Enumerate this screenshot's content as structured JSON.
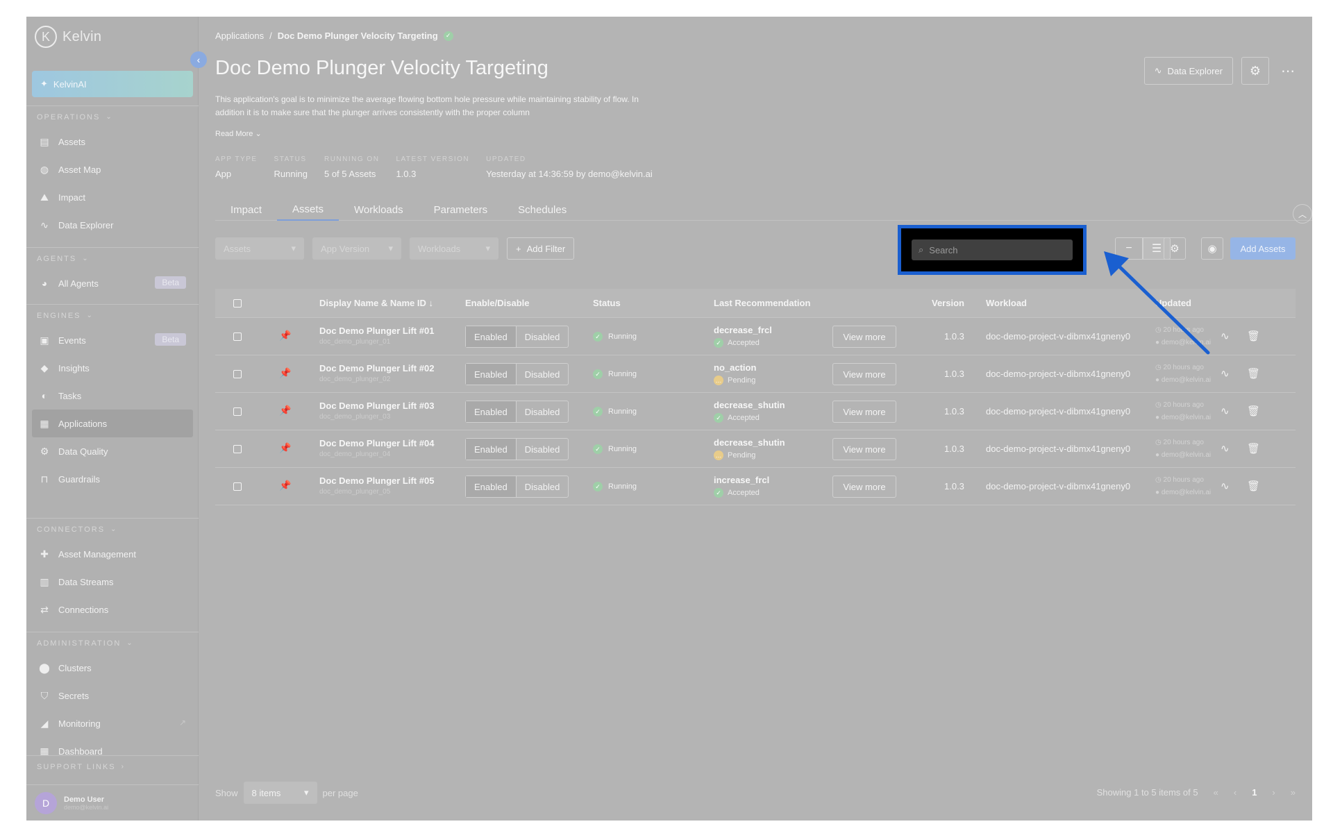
{
  "brand": {
    "logo_letter": "K",
    "name": "Kelvin"
  },
  "sidebar": {
    "kelvinai": "KelvinAI",
    "sections": [
      {
        "title": "OPERATIONS",
        "items": [
          "Assets",
          "Asset Map",
          "Impact",
          "Data Explorer"
        ]
      },
      {
        "title": "AGENTS",
        "items": [
          "All Agents"
        ]
      },
      {
        "title": "ENGINES",
        "items": [
          "Events",
          "Insights",
          "Tasks",
          "Applications",
          "Data Quality",
          "Guardrails"
        ]
      },
      {
        "title": "CONNECTORS",
        "items": [
          "Asset Management",
          "Data Streams",
          "Connections"
        ]
      },
      {
        "title": "ADMINISTRATION",
        "items": [
          "Clusters",
          "Secrets",
          "Monitoring",
          "Dashboard"
        ]
      }
    ],
    "badge": "Beta",
    "support_links": "SUPPORT LINKS",
    "user": {
      "initial": "D",
      "name": "Demo User",
      "email": "demo@kelvin.ai"
    }
  },
  "breadcrumb": {
    "root": "Applications",
    "separator": "/",
    "current": "Doc Demo Plunger Velocity Targeting"
  },
  "page": {
    "title": "Doc Demo Plunger Velocity Targeting",
    "description": "This application's goal is to minimize the average flowing bottom hole pressure while maintaining stability of flow. In addition it is to make sure that the plunger arrives consistently with the proper column",
    "read_more": "Read More",
    "data_explorer_button": "Data Explorer"
  },
  "meta": [
    {
      "label": "APP TYPE",
      "value": "App"
    },
    {
      "label": "STATUS",
      "value": "Running"
    },
    {
      "label": "RUNNING ON",
      "value": "5 of 5 Assets"
    },
    {
      "label": "LATEST VERSION",
      "value": "1.0.3"
    },
    {
      "label": "UPDATED",
      "value": "Yesterday at 14:36:59 by demo@kelvin.ai"
    }
  ],
  "tabs": [
    "Impact",
    "Assets",
    "Workloads",
    "Parameters",
    "Schedules"
  ],
  "active_tab": "Assets",
  "filters": {
    "assets": "Assets",
    "app_version": "App Version",
    "workloads": "Workloads",
    "add_filter": "Add Filter"
  },
  "search": {
    "placeholder": "Search"
  },
  "add_assets": "Add Assets",
  "table": {
    "headers": {
      "name": "Display Name & Name ID",
      "enable": "Enable/Disable",
      "status": "Status",
      "recommendation": "Last Recommendation",
      "version": "Version",
      "workload": "Workload",
      "updated": "Updated"
    },
    "enabled_label": "Enabled",
    "disabled_label": "Disabled",
    "view_more_label": "View more",
    "rows": [
      {
        "name": "Doc Demo Plunger Lift #01",
        "name_id": "doc_demo_plunger_01",
        "status": "Running",
        "rec": "decrease_frcl",
        "rec_status": "Accepted",
        "version": "1.0.3",
        "workload": "doc-demo-project-v-dibmx41gneny0",
        "updated_time": "20 hours ago",
        "updated_by": "demo@kelvin.ai"
      },
      {
        "name": "Doc Demo Plunger Lift #02",
        "name_id": "doc_demo_plunger_02",
        "status": "Running",
        "rec": "no_action",
        "rec_status": "Pending",
        "version": "1.0.3",
        "workload": "doc-demo-project-v-dibmx41gneny0",
        "updated_time": "20 hours ago",
        "updated_by": "demo@kelvin.ai"
      },
      {
        "name": "Doc Demo Plunger Lift #03",
        "name_id": "doc_demo_plunger_03",
        "status": "Running",
        "rec": "decrease_shutin",
        "rec_status": "Accepted",
        "version": "1.0.3",
        "workload": "doc-demo-project-v-dibmx41gneny0",
        "updated_time": "20 hours ago",
        "updated_by": "demo@kelvin.ai"
      },
      {
        "name": "Doc Demo Plunger Lift #04",
        "name_id": "doc_demo_plunger_04",
        "status": "Running",
        "rec": "decrease_shutin",
        "rec_status": "Pending",
        "version": "1.0.3",
        "workload": "doc-demo-project-v-dibmx41gneny0",
        "updated_time": "20 hours ago",
        "updated_by": "demo@kelvin.ai"
      },
      {
        "name": "Doc Demo Plunger Lift #05",
        "name_id": "doc_demo_plunger_05",
        "status": "Running",
        "rec": "increase_frcl",
        "rec_status": "Accepted",
        "version": "1.0.3",
        "workload": "doc-demo-project-v-dibmx41gneny0",
        "updated_time": "20 hours ago",
        "updated_by": "demo@kelvin.ai"
      }
    ]
  },
  "pagination": {
    "show": "Show",
    "page_size": "8 items",
    "per_page": "per page",
    "summary": "Showing 1 to 5 items of 5",
    "current_page": "1"
  },
  "colors": {
    "highlight_border": "#1a5fd0",
    "arrow": "#1a5fd0",
    "accent": "#7e9ed8"
  }
}
